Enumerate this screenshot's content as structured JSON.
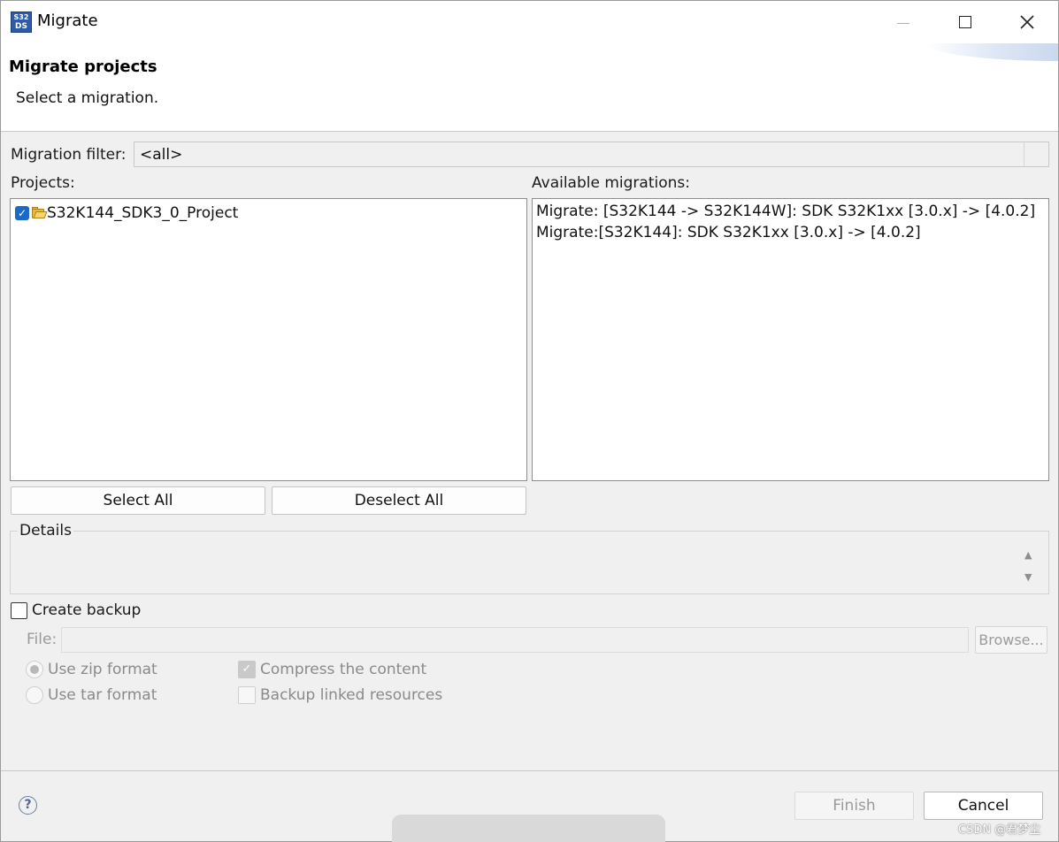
{
  "window": {
    "title": "Migrate",
    "icon_text_top": "S32",
    "icon_text_bottom": "DS"
  },
  "header": {
    "title": "Migrate projects",
    "subtitle": "Select a migration."
  },
  "filter": {
    "label": "Migration filter:",
    "value": "<all>"
  },
  "projects": {
    "label": "Projects:",
    "items": [
      {
        "name": "S32K144_SDK3_0_Project",
        "checked": true
      }
    ]
  },
  "migrations": {
    "label": "Available migrations:",
    "items": [
      "Migrate: [S32K144 -> S32K144W]: SDK S32K1xx [3.0.x] -> [4.0.2]",
      "Migrate:[S32K144]: SDK S32K1xx [3.0.x] -> [4.0.2]"
    ]
  },
  "buttons": {
    "select_all": "Select All",
    "deselect_all": "Deselect All",
    "browse": "Browse...",
    "finish": "Finish",
    "cancel": "Cancel"
  },
  "details": {
    "label": "Details"
  },
  "backup": {
    "create_label": "Create backup",
    "create_checked": false,
    "file_label": "File:",
    "file_value": "",
    "zip_label": "Use zip format",
    "tar_label": "Use tar format",
    "compress_label": "Compress the content",
    "linked_label": "Backup linked resources",
    "format_selected": "zip",
    "compress_checked": true,
    "linked_checked": false
  },
  "watermark": "CSDN @君梦尘"
}
